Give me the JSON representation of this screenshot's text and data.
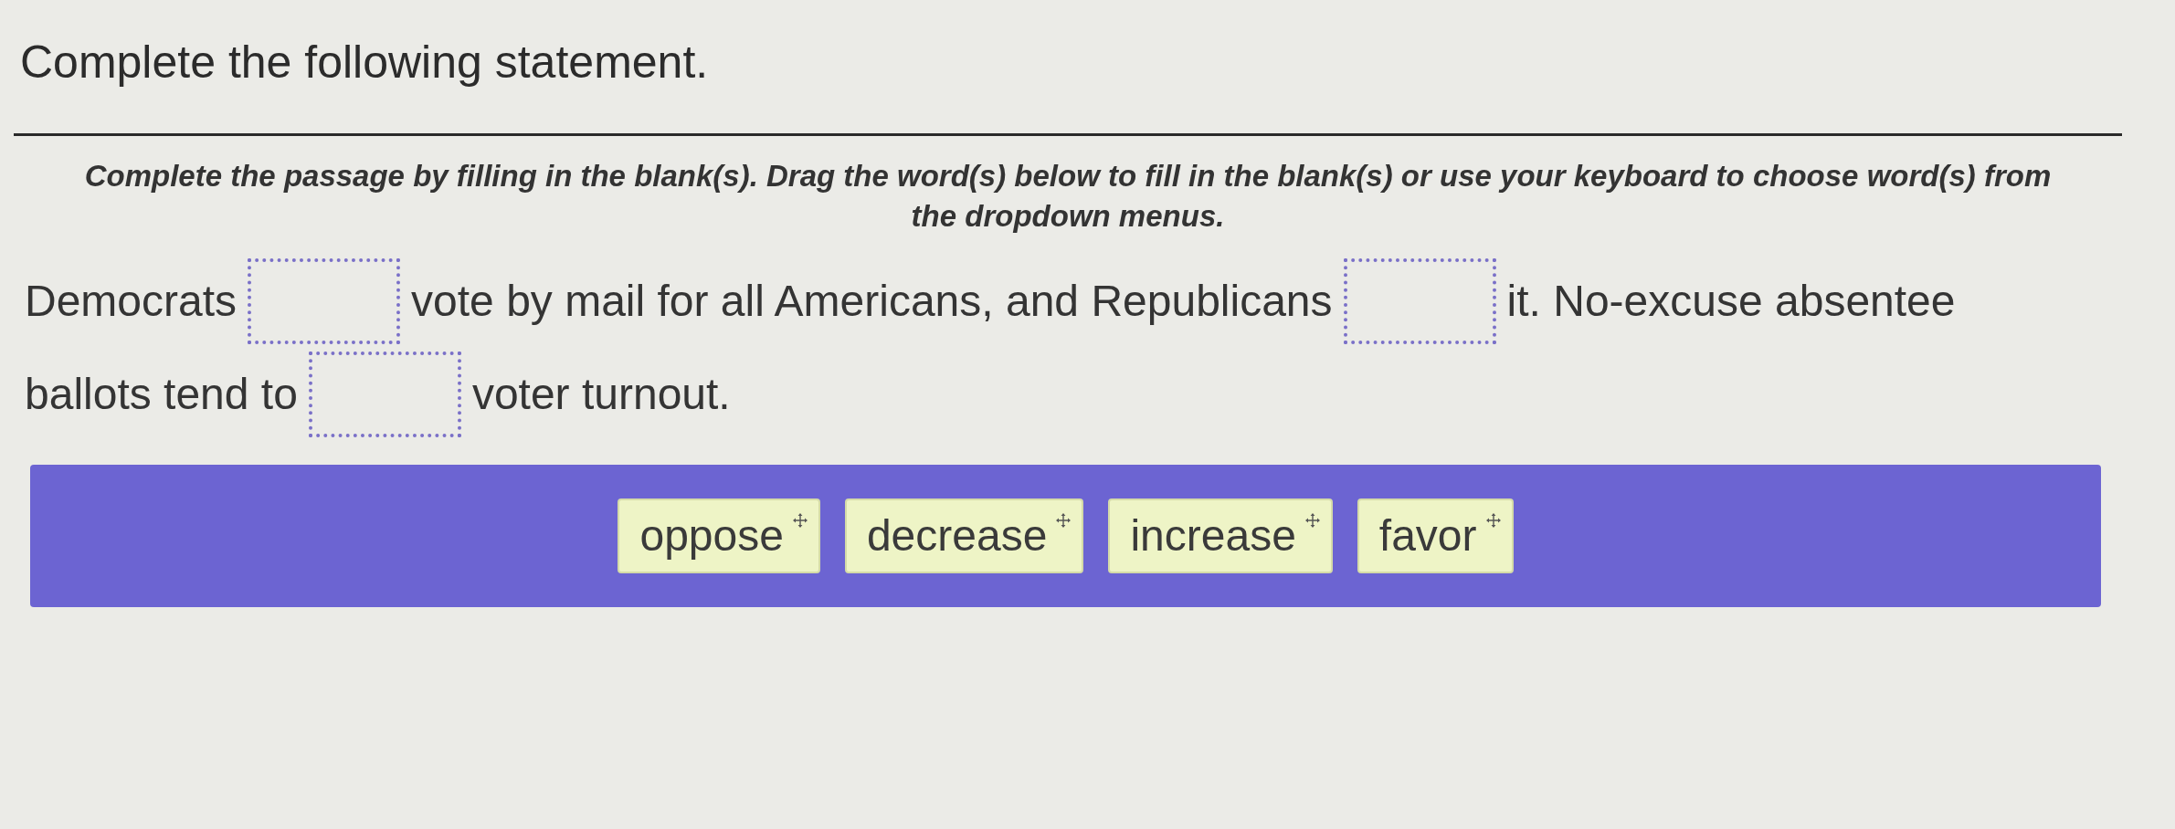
{
  "title": "Complete the following statement.",
  "instructions": "Complete the passage by filling in the blank(s). Drag the word(s) below to fill in the blank(s) or use your keyboard to choose word(s) from the dropdown menus.",
  "passage": {
    "lines": [
      [
        {
          "kind": "text",
          "text": "Democrats"
        },
        {
          "kind": "blank"
        },
        {
          "kind": "text",
          "text": "vote by mail for all Americans, and Republicans"
        },
        {
          "kind": "blank"
        },
        {
          "kind": "text",
          "text": "it. No-excuse absentee"
        }
      ],
      [
        {
          "kind": "text",
          "text": "ballots tend to"
        },
        {
          "kind": "blank"
        },
        {
          "kind": "text",
          "text": "voter turnout."
        }
      ]
    ]
  },
  "word_bank": [
    {
      "label": "oppose"
    },
    {
      "label": "decrease"
    },
    {
      "label": "increase"
    },
    {
      "label": "favor"
    }
  ]
}
